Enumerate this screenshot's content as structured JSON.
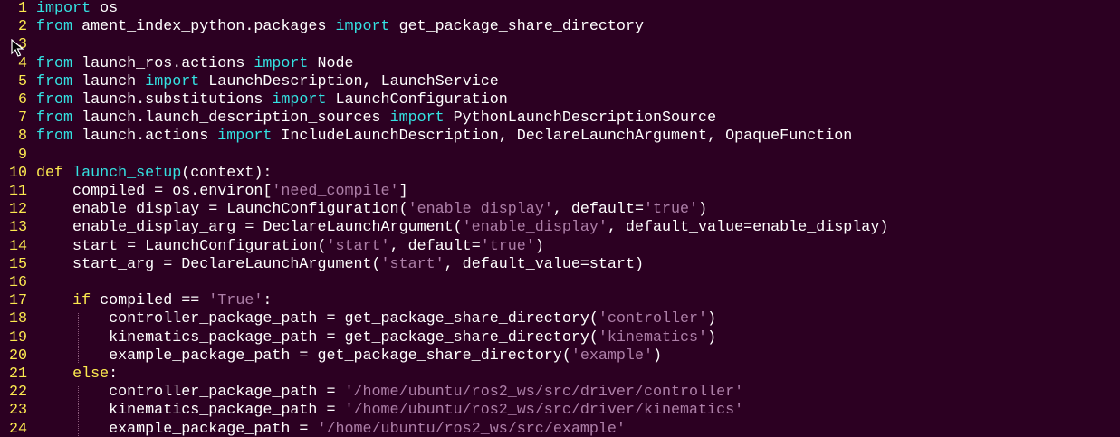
{
  "editor": {
    "background": "#2c0022",
    "line_number_color": "#fce94f",
    "keyword_color": "#fce94f",
    "import_color": "#34e2e2",
    "string_color": "#ad7fa8",
    "text_color": "#ffffff",
    "lines": [
      {
        "n": "1",
        "tokens": [
          {
            "t": "import",
            "c": "imp"
          },
          {
            "t": " os"
          }
        ]
      },
      {
        "n": "2",
        "tokens": [
          {
            "t": "from",
            "c": "imp"
          },
          {
            "t": " ament_index_python.packages "
          },
          {
            "t": "import",
            "c": "imp"
          },
          {
            "t": " get_package_share_directory"
          }
        ]
      },
      {
        "n": "3",
        "tokens": []
      },
      {
        "n": "4",
        "tokens": [
          {
            "t": "from",
            "c": "imp"
          },
          {
            "t": " launch_ros.actions "
          },
          {
            "t": "import",
            "c": "imp"
          },
          {
            "t": " Node"
          }
        ]
      },
      {
        "n": "5",
        "tokens": [
          {
            "t": "from",
            "c": "imp"
          },
          {
            "t": " launch "
          },
          {
            "t": "import",
            "c": "imp"
          },
          {
            "t": " LaunchDescription, LaunchService"
          }
        ]
      },
      {
        "n": "6",
        "tokens": [
          {
            "t": "from",
            "c": "imp"
          },
          {
            "t": " launch.substitutions "
          },
          {
            "t": "import",
            "c": "imp"
          },
          {
            "t": " LaunchConfiguration"
          }
        ]
      },
      {
        "n": "7",
        "tokens": [
          {
            "t": "from",
            "c": "imp"
          },
          {
            "t": " launch.launch_description_sources "
          },
          {
            "t": "import",
            "c": "imp"
          },
          {
            "t": " PythonLaunchDescriptionSource"
          }
        ]
      },
      {
        "n": "8",
        "tokens": [
          {
            "t": "from",
            "c": "imp"
          },
          {
            "t": " launch.actions "
          },
          {
            "t": "import",
            "c": "imp"
          },
          {
            "t": " IncludeLaunchDescription, DeclareLaunchArgument, OpaqueFunction"
          }
        ]
      },
      {
        "n": "9",
        "tokens": []
      },
      {
        "n": "10",
        "tokens": [
          {
            "t": "def",
            "c": "kw"
          },
          {
            "t": " "
          },
          {
            "t": "launch_setup",
            "c": "fn"
          },
          {
            "t": "(context):"
          }
        ]
      },
      {
        "n": "11",
        "tokens": [
          {
            "t": "    compiled = os.environ["
          },
          {
            "t": "'need_compile'",
            "c": "str"
          },
          {
            "t": "]"
          }
        ]
      },
      {
        "n": "12",
        "tokens": [
          {
            "t": "    enable_display = LaunchConfiguration("
          },
          {
            "t": "'enable_display'",
            "c": "str"
          },
          {
            "t": ", default="
          },
          {
            "t": "'true'",
            "c": "str"
          },
          {
            "t": ")"
          }
        ]
      },
      {
        "n": "13",
        "tokens": [
          {
            "t": "    enable_display_arg = DeclareLaunchArgument("
          },
          {
            "t": "'enable_display'",
            "c": "str"
          },
          {
            "t": ", default_value=enable_display)"
          }
        ]
      },
      {
        "n": "14",
        "tokens": [
          {
            "t": "    start = LaunchConfiguration("
          },
          {
            "t": "'start'",
            "c": "str"
          },
          {
            "t": ", default="
          },
          {
            "t": "'true'",
            "c": "str"
          },
          {
            "t": ")"
          }
        ]
      },
      {
        "n": "15",
        "tokens": [
          {
            "t": "    start_arg = DeclareLaunchArgument("
          },
          {
            "t": "'start'",
            "c": "str"
          },
          {
            "t": ", default_value=start)"
          }
        ]
      },
      {
        "n": "16",
        "tokens": []
      },
      {
        "n": "17",
        "tokens": [
          {
            "t": "    "
          },
          {
            "t": "if",
            "c": "kw"
          },
          {
            "t": " compiled == "
          },
          {
            "t": "'True'",
            "c": "str"
          },
          {
            "t": ":"
          }
        ]
      },
      {
        "n": "18",
        "tokens": [
          {
            "t": "        controller_package_path = get_package_share_directory("
          },
          {
            "t": "'controller'",
            "c": "str"
          },
          {
            "t": ")"
          }
        ]
      },
      {
        "n": "19",
        "tokens": [
          {
            "t": "        kinematics_package_path = get_package_share_directory("
          },
          {
            "t": "'kinematics'",
            "c": "str"
          },
          {
            "t": ")"
          }
        ]
      },
      {
        "n": "20",
        "tokens": [
          {
            "t": "        example_package_path = get_package_share_directory("
          },
          {
            "t": "'example'",
            "c": "str"
          },
          {
            "t": ")"
          }
        ]
      },
      {
        "n": "21",
        "tokens": [
          {
            "t": "    "
          },
          {
            "t": "else",
            "c": "kw"
          },
          {
            "t": ":"
          }
        ]
      },
      {
        "n": "22",
        "tokens": [
          {
            "t": "        controller_package_path = "
          },
          {
            "t": "'/home/ubuntu/ros2_ws/src/driver/controller'",
            "c": "str"
          }
        ]
      },
      {
        "n": "23",
        "tokens": [
          {
            "t": "        kinematics_package_path = "
          },
          {
            "t": "'/home/ubuntu/ros2_ws/src/driver/kinematics'",
            "c": "str"
          }
        ]
      },
      {
        "n": "24",
        "tokens": [
          {
            "t": "        example_package_path = "
          },
          {
            "t": "'/home/ubuntu/ros2_ws/src/example'",
            "c": "str"
          }
        ]
      }
    ]
  }
}
